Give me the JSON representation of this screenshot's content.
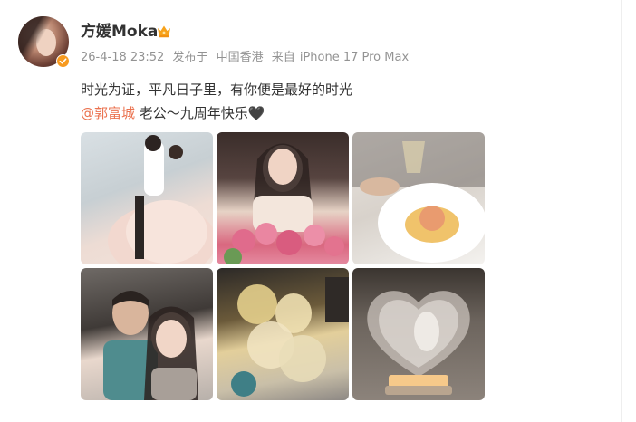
{
  "post": {
    "author": "方媛Moka",
    "date": "26-4-18 23:52",
    "published_label": "发布于",
    "location": "中国香港",
    "source_prefix": "来自",
    "source_device": "iPhone 17 Pro Max",
    "text_line1": "时光为证，平凡日子里，有你便是最好的时光",
    "mention": "@郭富城",
    "text_line2_rest": " 老公～九周年快乐🖤"
  },
  "colors": {
    "mention": "#eb7350",
    "verified_badge": "#f79a1f",
    "meta_text": "#939393",
    "body_text": "#333333"
  },
  "icons": {
    "verified": "verified-badge-icon",
    "member": "crown-icon"
  },
  "images": [
    {
      "name": "photo-wedding"
    },
    {
      "name": "photo-flowers"
    },
    {
      "name": "photo-dessert"
    },
    {
      "name": "photo-selfie"
    },
    {
      "name": "photo-toast"
    },
    {
      "name": "photo-crystal-heart"
    }
  ]
}
